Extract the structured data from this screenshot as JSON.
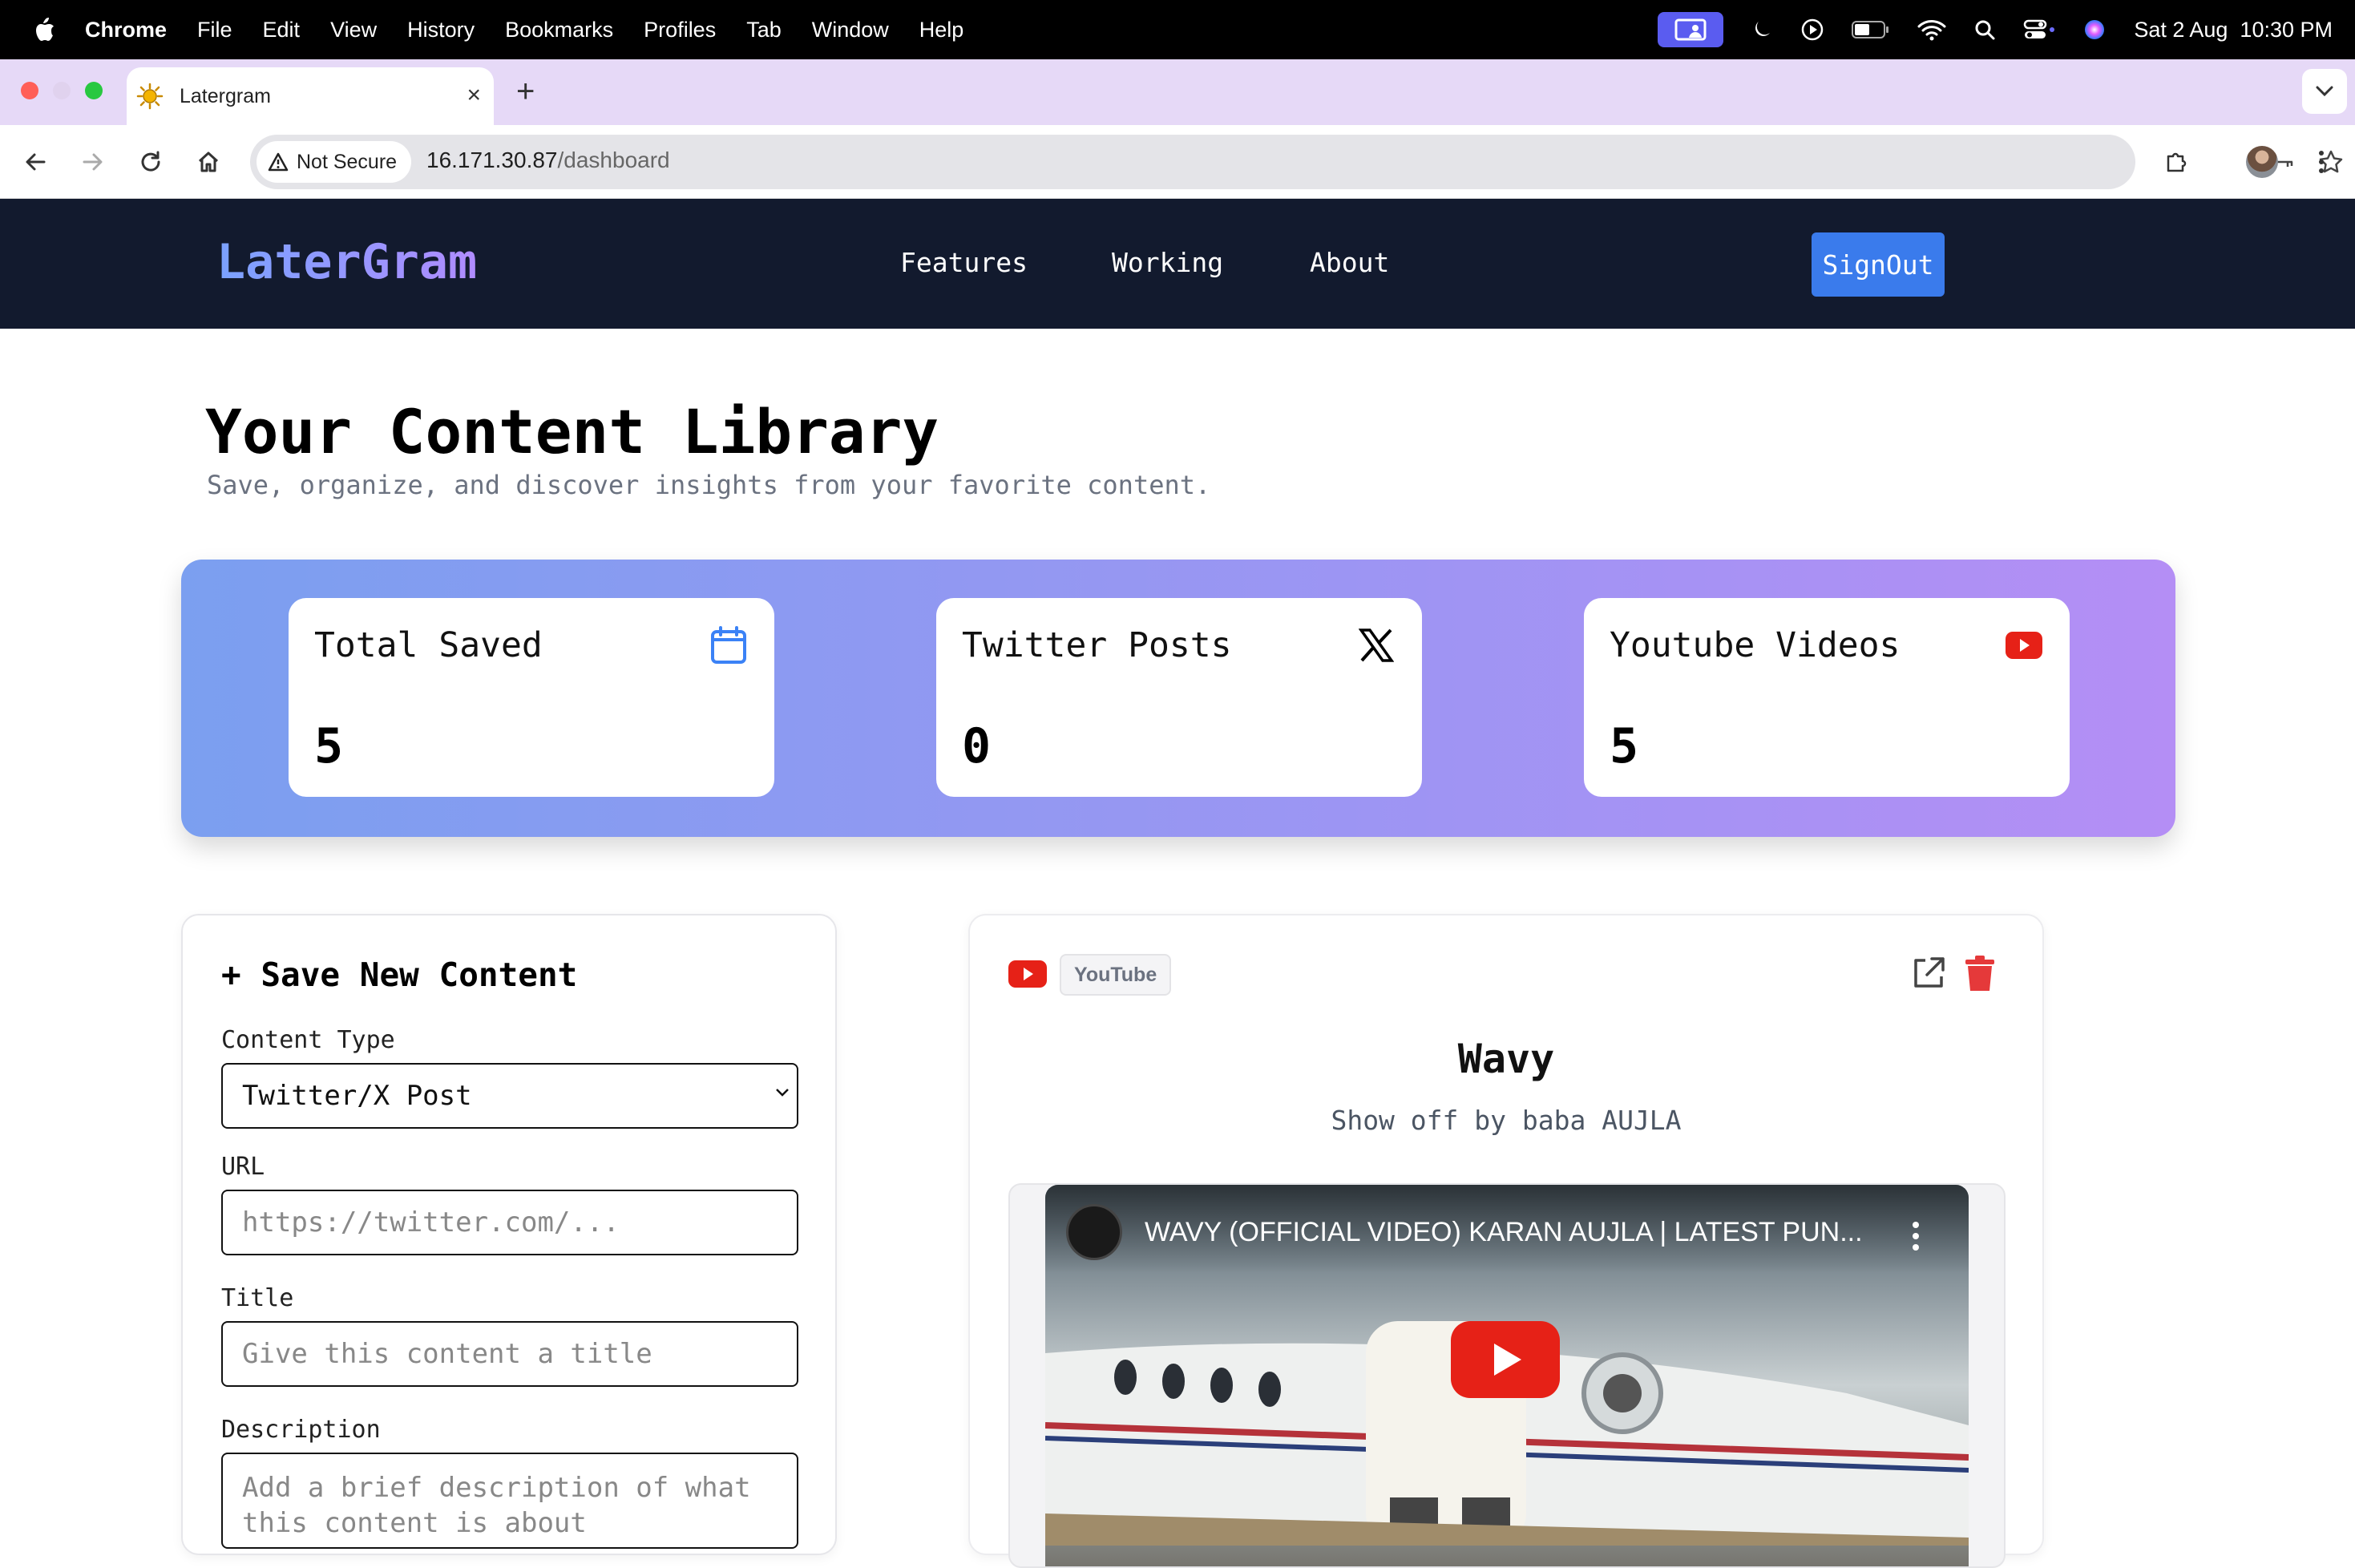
{
  "menubar": {
    "app": "Chrome",
    "items": [
      "File",
      "Edit",
      "View",
      "History",
      "Bookmarks",
      "Profiles",
      "Tab",
      "Window",
      "Help"
    ],
    "datetime": "Sat 2 Aug  10:30 PM"
  },
  "browser": {
    "tab_title": "Latergram",
    "security_label": "Not Secure",
    "url_host": "16.171.30.87",
    "url_path": "/dashboard"
  },
  "app": {
    "logo": "LaterGram",
    "nav": [
      "Features",
      "Working",
      "About"
    ],
    "signout_label": "SignOut"
  },
  "page": {
    "title": "Your Content Library",
    "subtitle": "Save, organize, and discover insights from your favorite content."
  },
  "stats": [
    {
      "label": "Total Saved",
      "value": "5",
      "icon": "calendar-icon"
    },
    {
      "label": "Twitter Posts",
      "value": "0",
      "icon": "x-logo-icon"
    },
    {
      "label": "Youtube Videos",
      "value": "5",
      "icon": "youtube-icon"
    }
  ],
  "form": {
    "title": "+ Save New Content",
    "content_type_label": "Content Type",
    "content_type_value": "Twitter/X Post",
    "url_label": "URL",
    "url_placeholder": "https://twitter.com/...",
    "title_label": "Title",
    "title_placeholder": "Give this content a title",
    "description_label": "Description",
    "description_placeholder": "Add a brief description of what this content is about"
  },
  "content": {
    "badge": "YouTube",
    "title": "Wavy",
    "description": "Show off by baba AUJLA",
    "video_title": "WAVY (OFFICIAL VIDEO) KARAN AUJLA | LATEST PUN..."
  },
  "colors": {
    "nav_bg": "#121a2e",
    "accent_blue": "#3a7bec",
    "youtube_red": "#e62117",
    "stats_gradient_start": "#7b9ff0",
    "stats_gradient_end": "#b48ef5"
  }
}
